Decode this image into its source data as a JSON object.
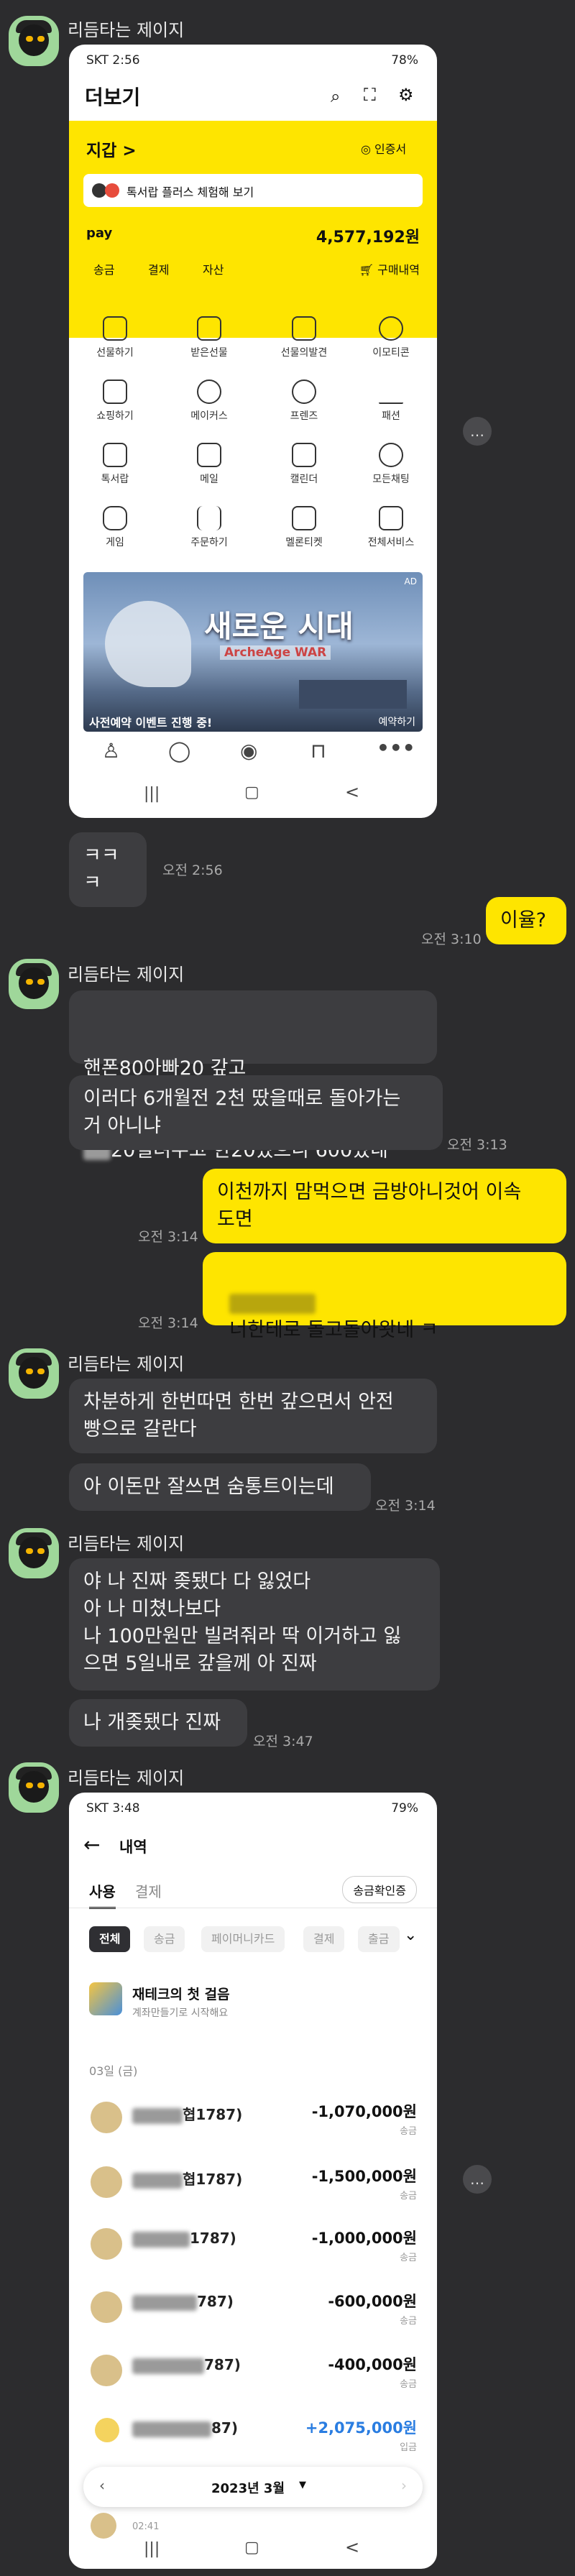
{
  "sender": "리듬타는 제이지",
  "phone1": {
    "status_left": "SKT 2:56",
    "status_right": "78%",
    "title": "더보기",
    "wallet_label": "지갑 >",
    "cert_label": "인증서",
    "promo": "톡서랍 플러스 체험해 보기",
    "pay_label": "pay",
    "balance": "4,577,192원",
    "tabs": [
      "송금",
      "결제",
      "자산"
    ],
    "order_history": "구매내역",
    "grid": [
      "선물하기",
      "받은선물",
      "선물의발견",
      "이모티콘",
      "쇼핑하기",
      "메이커스",
      "프렌즈",
      "패션",
      "톡서랍",
      "메일",
      "캘린더",
      "모든채팅",
      "게임",
      "주문하기",
      "멜론티켓",
      "전체서비스"
    ],
    "banner_title": "새로운 시대",
    "banner_sub": "ArcheAge WAR",
    "banner_caption": "사전예약 이벤트 진행 중!",
    "banner_right": "예약하기",
    "banner_ad": "AD"
  },
  "msgs": {
    "m1": "ㅋㅋㅋ",
    "t1": "오전 2:56",
    "m2": "이율?",
    "t2": "오전 3:10",
    "m3a": "핸폰80아빠20 갚고",
    "m3b": "20빌려주고 한20썼으니 600땄네",
    "m4": "이러다 6개월전 2천 땄을때로 돌아가는\n거 아니냐",
    "t4": "오전 3:13",
    "m5": "이천까지 맘먹으면 금방아니것어 이속\n도면",
    "t5": "오전 3:14",
    "m6": "너한테로 돌고돌아왓네 ㅋ",
    "t6": "오전 3:14",
    "m7": "차분하게 한번따면 한번 갚으면서 안전\n빵으로 갈란다",
    "m8": "아 이돈만 잘쓰면 숨통트이는데",
    "t8": "오전 3:14",
    "m9": "야 나 진짜 좆됐다 다 잃었다\n아 나 미쳤나보다\n나 100만원만 빌려줘라 딱 이거하고 잃\n으면 5일내로 갚을께 아 진짜",
    "m10": "나 개좆됐다 진짜",
    "t10": "오전 3:47"
  },
  "phone2": {
    "status_left": "SKT 3:48",
    "status_right": "79%",
    "title": "내역",
    "tab_use": "사용",
    "tab_pay": "결제",
    "confirm_btn": "송금확인증",
    "chips": [
      "전체",
      "송금",
      "페이머니카드",
      "결제",
      "출금"
    ],
    "promo_title": "재테크의 첫 걸음",
    "promo_sub": "계좌만들기로 시작해요",
    "date": "03일 (금)",
    "rows": [
      {
        "name": "협1787)",
        "amount": "-1,070,000원",
        "type": "송금"
      },
      {
        "name": "협1787)",
        "amount": "-1,500,000원",
        "type": "송금"
      },
      {
        "name": "1787)",
        "amount": "-1,000,000원",
        "type": "송금"
      },
      {
        "name": "787)",
        "amount": "-600,000원",
        "type": "송금"
      },
      {
        "name": "787)",
        "amount": "-400,000원",
        "type": "송금"
      },
      {
        "name": "87)",
        "amount": "+2,075,000원",
        "type": "입금"
      }
    ],
    "month": "2023년 3월",
    "time_bottom": "02:41"
  }
}
